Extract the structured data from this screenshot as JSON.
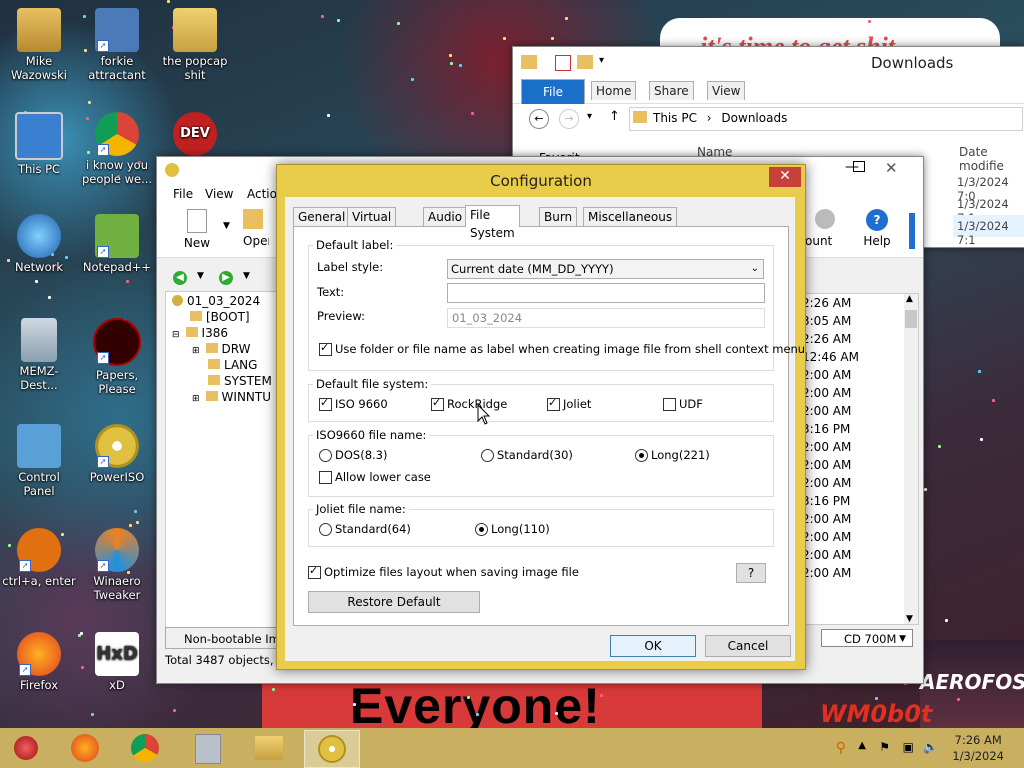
{
  "desktop": {
    "icons": [
      {
        "label": "Mike Wazowski"
      },
      {
        "label": "forkie attractant"
      },
      {
        "label": "the popcap shit"
      },
      {
        "label": "This PC"
      },
      {
        "label": "i know you people we..."
      },
      {
        "label": "DEV C++"
      },
      {
        "label": "Network"
      },
      {
        "label": "Notepad++"
      },
      {
        "label": "MEMZ-Dest..."
      },
      {
        "label": "Papers, Please"
      },
      {
        "label": "Control Panel"
      },
      {
        "label": "PowerISO"
      },
      {
        "label": "ctrl+a, enter"
      },
      {
        "label": "Winaero Tweaker"
      },
      {
        "label": "Firefox"
      },
      {
        "label": "xD"
      }
    ],
    "wallpaper": {
      "banner_text": "Everyone!",
      "top_text": "it's time to get shit",
      "right_text": "AEROFOS",
      "watermark": "WM0b0t"
    }
  },
  "explorer": {
    "title": "Downloads",
    "ribbon_tabs": [
      "File",
      "Home",
      "Share",
      "View"
    ],
    "breadcrumb": [
      "This PC",
      "Downloads"
    ],
    "column_name": "Name",
    "column_date": "Date modifie",
    "nav_label": "Favorit",
    "dates": [
      "1/3/2024 7:0",
      "1/3/2024 7:1",
      "1/3/2024 7:1"
    ]
  },
  "poweriso": {
    "menu": [
      "File",
      "View",
      "Actio"
    ],
    "toolbar": {
      "new": "New",
      "open": "Open",
      "mount": "ount",
      "help": "Help"
    },
    "tree": {
      "root": "01_03_2024",
      "items": [
        "[BOOT]",
        "I386",
        "DRW",
        "LANG",
        "SYSTEM",
        "WINNTU"
      ]
    },
    "times": [
      "2:26 AM",
      "3:05 AM",
      "2:26 AM",
      "12:46 AM",
      "2:00 AM",
      "2:00 AM",
      "2:00 AM",
      "3:16 PM",
      "2:00 AM",
      "2:00 AM",
      "2:00 AM",
      "3:16 PM",
      "2:00 AM",
      "2:00 AM",
      "2:00 AM",
      "2:00 AM"
    ],
    "boot_status": "Non-bootable Imag",
    "media": "CD 700M",
    "status_total": "Total 3487 objects, 22"
  },
  "dialog": {
    "title": "Configuration",
    "tabs": [
      "General",
      "Virtual Drive",
      "Audio",
      "File System",
      "Burn",
      "Miscellaneous"
    ],
    "active_tab": "File System",
    "default_label": {
      "group": "Default label:",
      "style_label": "Label style:",
      "style_value": "Current date (MM_DD_YYYY)",
      "text_label": "Text:",
      "text_value": "",
      "preview_label": "Preview:",
      "preview_value": "01_03_2024",
      "use_name_label": "Use folder or file name as label when creating image file from shell context menu",
      "use_name_checked": true
    },
    "default_fs": {
      "group": "Default file system:",
      "options": [
        {
          "label": "ISO 9660",
          "checked": true
        },
        {
          "label": "RockRidge",
          "checked": true
        },
        {
          "label": "Joliet",
          "checked": true
        },
        {
          "label": "UDF",
          "checked": false
        }
      ]
    },
    "iso_name": {
      "group": "ISO9660 file name:",
      "options": [
        {
          "label": "DOS(8.3)",
          "selected": false
        },
        {
          "label": "Standard(30)",
          "selected": false
        },
        {
          "label": "Long(221)",
          "selected": true
        }
      ],
      "lower_case_label": "Allow lower case",
      "lower_case_checked": false
    },
    "joliet_name": {
      "group": "Joliet file name:",
      "options": [
        {
          "label": "Standard(64)",
          "selected": false
        },
        {
          "label": "Long(110)",
          "selected": true
        }
      ]
    },
    "optimize_label": "Optimize files layout when saving image file",
    "optimize_checked": true,
    "help_button": "?",
    "restore_button": "Restore Default",
    "ok_button": "OK",
    "cancel_button": "Cancel"
  },
  "taskbar": {
    "time": "7:26 AM",
    "date": "1/3/2024"
  },
  "colors": {
    "dialog_frame": "#e8cc4a",
    "taskbar": "#c8b060",
    "close_red": "#c7413a",
    "explorer_file_tab": "#1a6fc9"
  }
}
